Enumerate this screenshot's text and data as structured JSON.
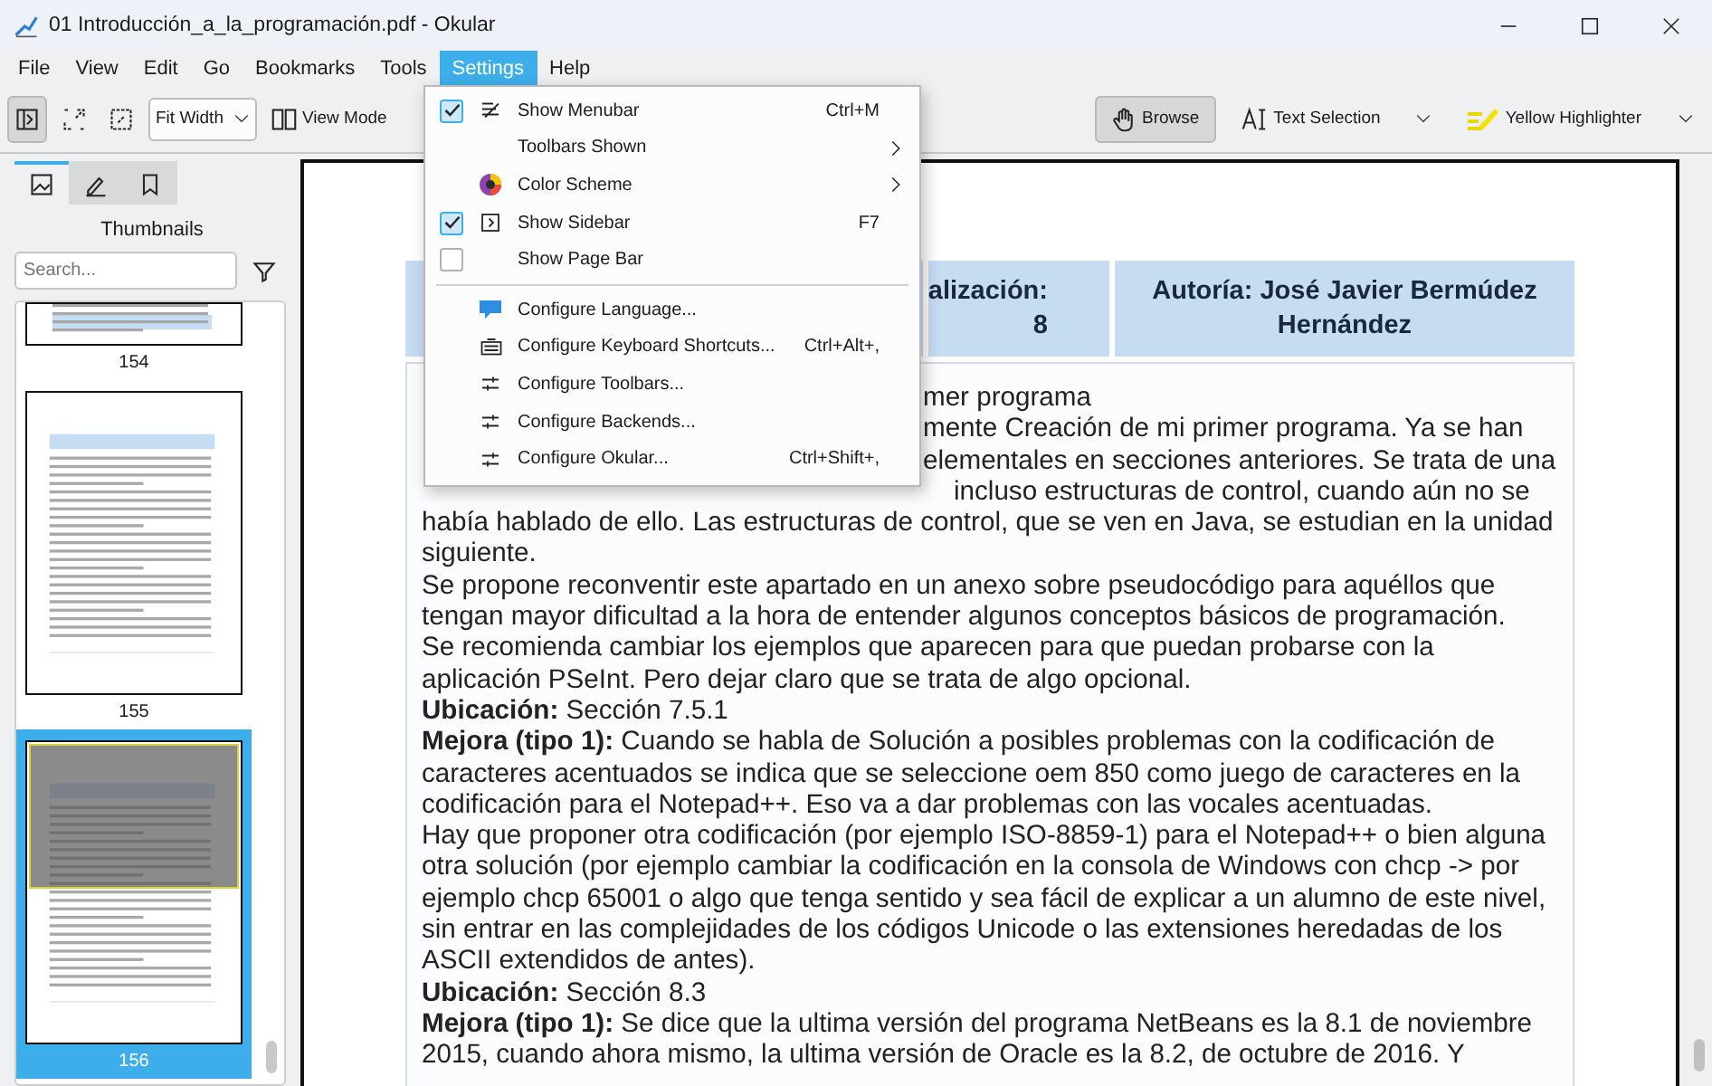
{
  "window": {
    "title": "01 Introducción_a_la_programación.pdf  - Okular"
  },
  "menubar": [
    {
      "label": "File",
      "selected": false
    },
    {
      "label": "View",
      "selected": false
    },
    {
      "label": "Edit",
      "selected": false
    },
    {
      "label": "Go",
      "selected": false
    },
    {
      "label": "Bookmarks",
      "selected": false
    },
    {
      "label": "Tools",
      "selected": false
    },
    {
      "label": "Settings",
      "selected": true
    },
    {
      "label": "Help",
      "selected": false
    }
  ],
  "toolbar": {
    "sidebar_toggle": {
      "selected": true
    },
    "zoom_mode": "Fit Width",
    "view_mode": "View Mode",
    "tools": [
      {
        "label": "Browse",
        "selected": true
      },
      {
        "label": "Text Selection",
        "selected": false
      },
      {
        "label": "Yellow Highlighter",
        "selected": false
      }
    ]
  },
  "sidebar": {
    "tabs": [
      {
        "selected": true
      },
      {
        "selected": false
      },
      {
        "selected": false
      }
    ],
    "title": "Thumbnails",
    "search": {
      "placeholder": "Search..."
    },
    "thumbnails": [
      {
        "page": "154",
        "kind": "tail",
        "selected": false
      },
      {
        "page": "155",
        "kind": "full",
        "selected": false
      },
      {
        "page": "156",
        "kind": "full",
        "selected": true
      }
    ]
  },
  "settings_menu": {
    "items": [
      {
        "kind": "toggle",
        "label": "Show Menubar",
        "checked": true,
        "shortcut": "Ctrl+M"
      },
      {
        "kind": "submenu",
        "label": "Toolbars Shown"
      },
      {
        "kind": "submenu",
        "label": "Color Scheme"
      },
      {
        "kind": "toggle",
        "label": "Show Sidebar",
        "checked": true,
        "shortcut": "F7"
      },
      {
        "kind": "toggle",
        "label": "Show Page Bar",
        "checked": false
      },
      {
        "kind": "separator"
      },
      {
        "kind": "action",
        "label": "Configure Language..."
      },
      {
        "kind": "action",
        "label": "Configure Keyboard Shortcuts...",
        "shortcut": "Ctrl+Alt+,"
      },
      {
        "kind": "action",
        "label": "Configure Toolbars..."
      },
      {
        "kind": "action",
        "label": "Configure Backends..."
      },
      {
        "kind": "action",
        "label": "Configure Okular...",
        "shortcut": "Ctrl+Shift+,"
      }
    ]
  },
  "document": {
    "header_cells": [
      {
        "lines": [
          "alización:",
          "8"
        ]
      },
      {
        "lines": [
          "Autoría: José Javier Bermúdez",
          "Hernández"
        ]
      }
    ],
    "lines": [
      {
        "kind": "partial",
        "text": "mer programa"
      },
      {
        "kind": "partial",
        "text": "mente Creación de mi primer programa. Ya se han"
      },
      {
        "kind": "partial",
        "text": "elementales en secciones anteriores. Se trata de una"
      },
      {
        "kind": "below_menu",
        "text": "incluso estructuras de control, cuando aún no se"
      },
      {
        "kind": "full",
        "text": "había hablado de ello. Las estructuras de control, que se ven en Java, se estudian en la unidad"
      },
      {
        "kind": "full",
        "text": "siguiente."
      },
      {
        "kind": "full",
        "text": "Se propone reconventir este apartado en un anexo sobre pseudocódigo para aquéllos que"
      },
      {
        "kind": "full",
        "text": "tengan mayor dificultad a la hora de entender algunos conceptos básicos de programación."
      },
      {
        "kind": "full",
        "text": "Se recomienda cambiar los ejemplos que aparecen para que puedan probarse con la"
      },
      {
        "kind": "full",
        "text": "aplicación PSeInt. Pero dejar claro que se trata de algo opcional."
      },
      {
        "kind": "full",
        "text": "**Ubicación:** Sección 7.5.1"
      },
      {
        "kind": "full",
        "text": "**Mejora (tipo 1):** Cuando se habla de Solución a posibles problemas con la codificación de"
      },
      {
        "kind": "full",
        "text": "caracteres acentuados se indica que se seleccione oem 850 como juego de caracteres en la"
      },
      {
        "kind": "full",
        "text": "codificación para el Notepad++. Eso va a dar problemas con las vocales acentuadas."
      },
      {
        "kind": "full",
        "text": "Hay que proponer otra codificación (por ejemplo ISO-8859-1) para el Notepad++ o bien alguna"
      },
      {
        "kind": "full",
        "text": "otra solución (por ejemplo cambiar la codificación en la consola de Windows con chcp -> por"
      },
      {
        "kind": "full",
        "text": "ejemplo chcp 65001 o algo que tenga sentido y sea fácil de explicar a un alumno de este nivel,"
      },
      {
        "kind": "full",
        "text": "sin entrar en las complejidades de los códigos Unicode o las extensiones heredadas de los"
      },
      {
        "kind": "full",
        "text": "ASCII extendidos de antes)."
      },
      {
        "kind": "full",
        "text": "**Ubicación:** Sección 8.3"
      },
      {
        "kind": "full",
        "text": "**Mejora (tipo 1):** Se dice que la ultima versión del programa NetBeans es la 8.1 de noviembre"
      },
      {
        "kind": "full",
        "text": "2015, cuando ahora mismo, la ultima versión de Oracle es la 8.2, de octubre de 2016. Y"
      }
    ]
  }
}
